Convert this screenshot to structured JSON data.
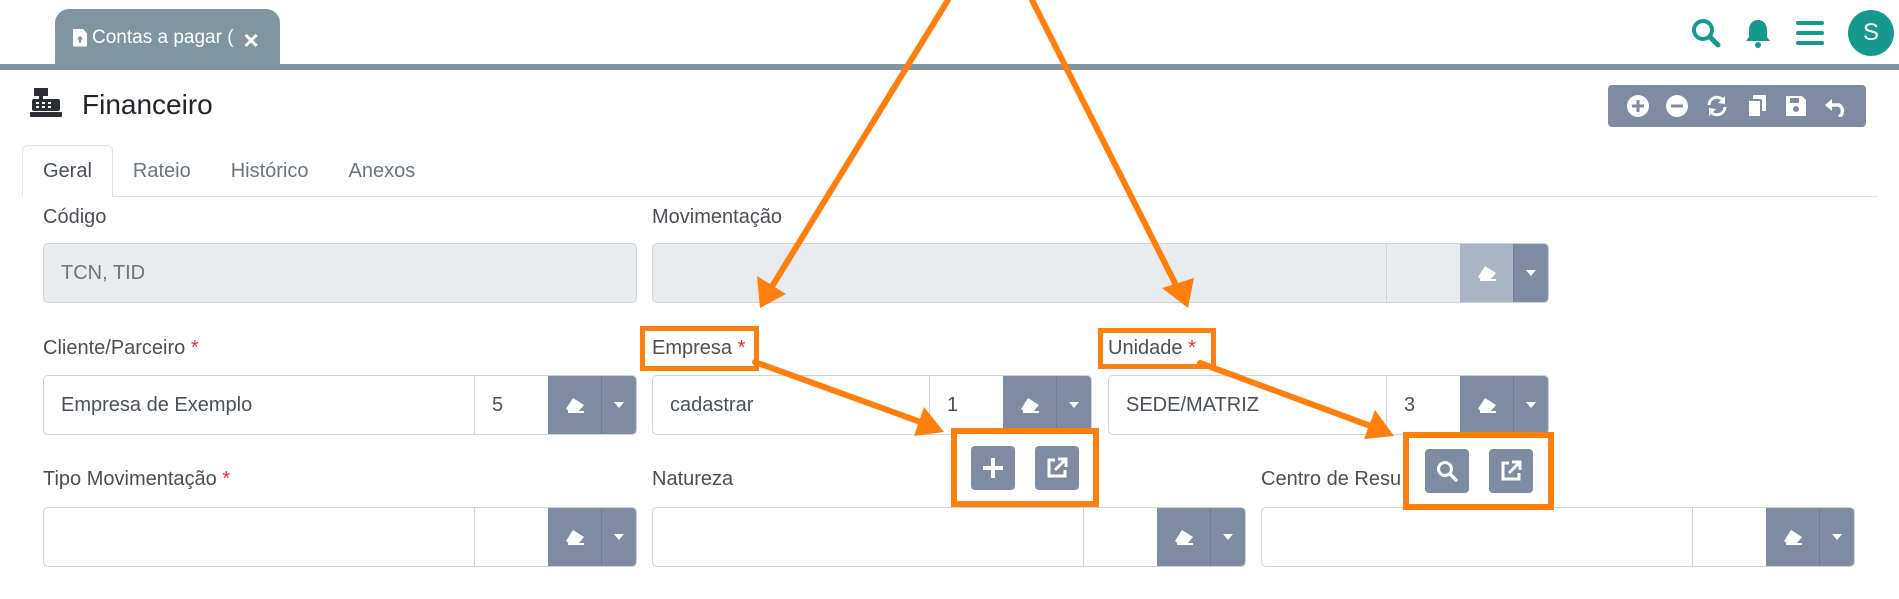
{
  "top_tab": {
    "label": "Contas a pagar (",
    "icon": "file-upload-icon",
    "close_icon": "close-icon"
  },
  "top_icons": [
    "search-icon",
    "bell-icon",
    "menu-icon"
  ],
  "user": {
    "avatar_letter": "S"
  },
  "colors": {
    "accent": "#159a8d",
    "tab_bar": "#7f95a0",
    "button": "#7f8ba3",
    "highlight": "#ff7f0e",
    "required": "#e3342f"
  },
  "page": {
    "title": "Financeiro",
    "icon": "cash-register-icon"
  },
  "toolbar_icons": [
    "plus-circle-icon",
    "minus-circle-icon",
    "sync-icon",
    "copy-icon",
    "save-icon",
    "undo-icon"
  ],
  "tabs": [
    {
      "label": "Geral",
      "active": true
    },
    {
      "label": "Rateio"
    },
    {
      "label": "Histórico"
    },
    {
      "label": "Anexos"
    }
  ],
  "form": {
    "codigo": {
      "label": "Código",
      "value": "TCN, TID"
    },
    "movimentacao": {
      "label": "Movimentação",
      "value": "",
      "code": ""
    },
    "cliente": {
      "label": "Cliente/Parceiro",
      "required_mark": "*",
      "value": "Empresa de Exemplo",
      "code": "5"
    },
    "empresa": {
      "label": "Empresa",
      "required_mark": "*",
      "value": "cadastrar",
      "code": "1"
    },
    "unidade": {
      "label": "Unidade",
      "required_mark": "*",
      "value": "SEDE/MATRIZ",
      "code": "3"
    },
    "tipo_movimentacao": {
      "label": "Tipo Movimentação",
      "required_mark": "*",
      "value": "",
      "code": ""
    },
    "natureza": {
      "label": "Natureza",
      "value": "",
      "code": ""
    },
    "centro_resultado": {
      "label": "Centro de Resu",
      "value": "",
      "code": ""
    }
  },
  "popups": {
    "empresa": [
      "plus-icon",
      "external-link-icon"
    ],
    "unidade": [
      "search-icon",
      "external-link-icon"
    ]
  }
}
